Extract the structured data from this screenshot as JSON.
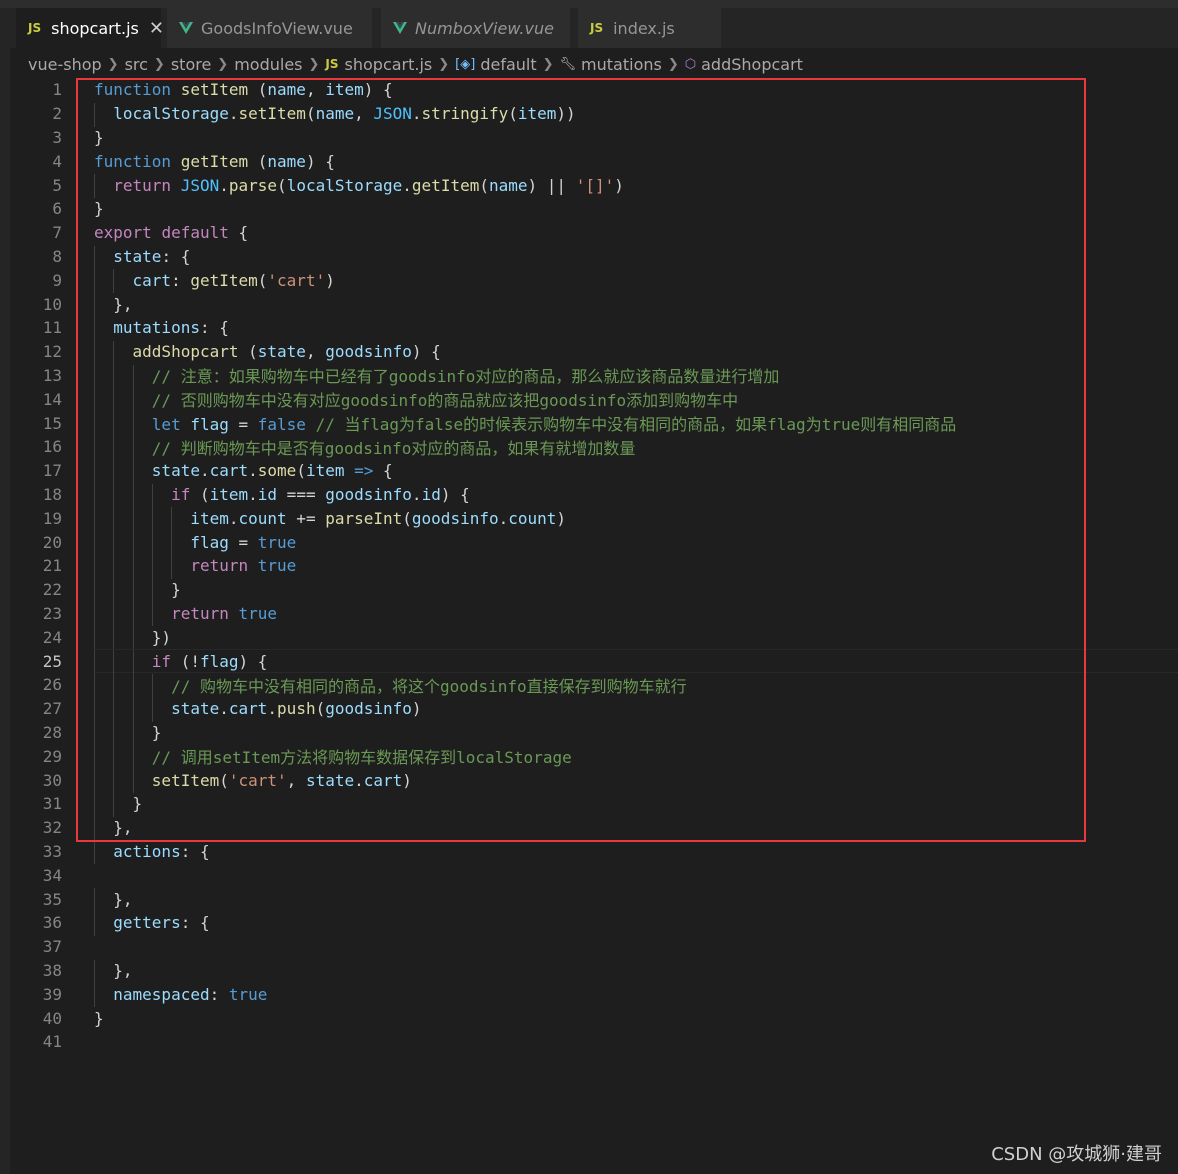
{
  "tabs": [
    {
      "icon": "JS",
      "label": "shopcart.js",
      "active": true,
      "close": "✕"
    },
    {
      "icon": "vue",
      "label": "GoodsInfoView.vue"
    },
    {
      "icon": "vue",
      "label": "NumboxView.vue"
    },
    {
      "icon": "JS",
      "label": "index.js"
    }
  ],
  "breadcrumb": [
    "vue-shop",
    "src",
    "store",
    "modules",
    "shopcart.js",
    "default",
    "mutations",
    "addShopcart"
  ],
  "breadcrumb_js_icon": "JS",
  "line_numbers": [
    "1",
    "2",
    "3",
    "4",
    "5",
    "6",
    "7",
    "8",
    "9",
    "10",
    "11",
    "12",
    "13",
    "14",
    "15",
    "16",
    "17",
    "18",
    "19",
    "20",
    "21",
    "22",
    "23",
    "24",
    "25",
    "26",
    "27",
    "28",
    "29",
    "30",
    "31",
    "32",
    "33",
    "34",
    "35",
    "36",
    "37",
    "38",
    "39",
    "40",
    "41"
  ],
  "code_lines": [
    [
      [
        "kw",
        "function "
      ],
      [
        "fn",
        "setItem "
      ],
      [
        "",
        "("
      ],
      [
        "var",
        "name"
      ],
      [
        "",
        ", "
      ],
      [
        "var",
        "item"
      ],
      [
        "",
        ") {"
      ]
    ],
    [
      [
        "",
        "  "
      ],
      [
        "var",
        "localStorage"
      ],
      [
        "",
        "."
      ],
      [
        "fn",
        "setItem"
      ],
      [
        "",
        "("
      ],
      [
        "var",
        "name"
      ],
      [
        "",
        ", "
      ],
      [
        "obj",
        "JSON"
      ],
      [
        "",
        "."
      ],
      [
        "fn",
        "stringify"
      ],
      [
        "",
        "("
      ],
      [
        "var",
        "item"
      ],
      [
        "",
        "))"
      ]
    ],
    [
      [
        "",
        "}"
      ]
    ],
    [
      [
        "kw",
        "function "
      ],
      [
        "fn",
        "getItem "
      ],
      [
        "",
        "("
      ],
      [
        "var",
        "name"
      ],
      [
        "",
        ") {"
      ]
    ],
    [
      [
        "",
        "  "
      ],
      [
        "ctl",
        "return "
      ],
      [
        "obj",
        "JSON"
      ],
      [
        "",
        "."
      ],
      [
        "fn",
        "parse"
      ],
      [
        "",
        "("
      ],
      [
        "var",
        "localStorage"
      ],
      [
        "",
        "."
      ],
      [
        "fn",
        "getItem"
      ],
      [
        "",
        "("
      ],
      [
        "var",
        "name"
      ],
      [
        "",
        ") || "
      ],
      [
        "str",
        "'[]'"
      ],
      [
        "",
        ")"
      ]
    ],
    [
      [
        "",
        "}"
      ]
    ],
    [
      [
        "ctl",
        "export "
      ],
      [
        "ctl",
        "default "
      ],
      [
        "",
        "{"
      ]
    ],
    [
      [
        "",
        "  "
      ],
      [
        "var",
        "state"
      ],
      [
        "",
        ": {"
      ]
    ],
    [
      [
        "",
        "    "
      ],
      [
        "var",
        "cart"
      ],
      [
        "",
        ": "
      ],
      [
        "fn",
        "getItem"
      ],
      [
        "",
        "("
      ],
      [
        "str",
        "'cart'"
      ],
      [
        "",
        ")"
      ]
    ],
    [
      [
        "",
        "  },"
      ]
    ],
    [
      [
        "",
        "  "
      ],
      [
        "var",
        "mutations"
      ],
      [
        "",
        ": {"
      ]
    ],
    [
      [
        "",
        "    "
      ],
      [
        "fn",
        "addShopcart "
      ],
      [
        "",
        "("
      ],
      [
        "var",
        "state"
      ],
      [
        "",
        ", "
      ],
      [
        "var",
        "goodsinfo"
      ],
      [
        "",
        ") {"
      ]
    ],
    [
      [
        "",
        "      "
      ],
      [
        "cmt",
        "// 注意：如果购物车中已经有了goodsinfo对应的商品，那么就应该商品数量进行增加"
      ]
    ],
    [
      [
        "",
        "      "
      ],
      [
        "cmt",
        "// 否则购物车中没有对应goodsinfo的商品就应该把goodsinfo添加到购物车中"
      ]
    ],
    [
      [
        "",
        "      "
      ],
      [
        "kw",
        "let "
      ],
      [
        "var",
        "flag"
      ],
      [
        "",
        " = "
      ],
      [
        "kw",
        "false "
      ],
      [
        "cmt",
        "// 当flag为false的时候表示购物车中没有相同的商品，如果flag为true则有相同商品"
      ]
    ],
    [
      [
        "",
        "      "
      ],
      [
        "cmt",
        "// 判断购物车中是否有goodsinfo对应的商品，如果有就增加数量"
      ]
    ],
    [
      [
        "",
        "      "
      ],
      [
        "var",
        "state"
      ],
      [
        "",
        "."
      ],
      [
        "var",
        "cart"
      ],
      [
        "",
        "."
      ],
      [
        "fn",
        "some"
      ],
      [
        "",
        "("
      ],
      [
        "var",
        "item"
      ],
      [
        "kw",
        " => "
      ],
      [
        "",
        "{"
      ]
    ],
    [
      [
        "",
        "        "
      ],
      [
        "ctl",
        "if "
      ],
      [
        "",
        "("
      ],
      [
        "var",
        "item"
      ],
      [
        "",
        "."
      ],
      [
        "var",
        "id"
      ],
      [
        "",
        " === "
      ],
      [
        "var",
        "goodsinfo"
      ],
      [
        "",
        "."
      ],
      [
        "var",
        "id"
      ],
      [
        "",
        ") {"
      ]
    ],
    [
      [
        "",
        "          "
      ],
      [
        "var",
        "item"
      ],
      [
        "",
        "."
      ],
      [
        "var",
        "count"
      ],
      [
        "",
        " += "
      ],
      [
        "fn",
        "parseInt"
      ],
      [
        "",
        "("
      ],
      [
        "var",
        "goodsinfo"
      ],
      [
        "",
        "."
      ],
      [
        "var",
        "count"
      ],
      [
        "",
        ")"
      ]
    ],
    [
      [
        "",
        "          "
      ],
      [
        "var",
        "flag"
      ],
      [
        "",
        " = "
      ],
      [
        "kw",
        "true"
      ]
    ],
    [
      [
        "",
        "          "
      ],
      [
        "ctl",
        "return "
      ],
      [
        "kw",
        "true"
      ]
    ],
    [
      [
        "",
        "        }"
      ]
    ],
    [
      [
        "",
        "        "
      ],
      [
        "ctl",
        "return "
      ],
      [
        "kw",
        "true"
      ]
    ],
    [
      [
        "",
        "      })"
      ]
    ],
    [
      [
        "",
        "      "
      ],
      [
        "ctl",
        "if "
      ],
      [
        "",
        "(!"
      ],
      [
        "var",
        "flag"
      ],
      [
        "",
        ") {"
      ]
    ],
    [
      [
        "",
        "        "
      ],
      [
        "cmt",
        "// 购物车中没有相同的商品，将这个goodsinfo直接保存到购物车就行"
      ]
    ],
    [
      [
        "",
        "        "
      ],
      [
        "var",
        "state"
      ],
      [
        "",
        "."
      ],
      [
        "var",
        "cart"
      ],
      [
        "",
        "."
      ],
      [
        "fn",
        "push"
      ],
      [
        "",
        "("
      ],
      [
        "var",
        "goodsinfo"
      ],
      [
        "",
        ")"
      ]
    ],
    [
      [
        "",
        "      }"
      ]
    ],
    [
      [
        "",
        "      "
      ],
      [
        "cmt",
        "// 调用setItem方法将购物车数据保存到localStorage"
      ]
    ],
    [
      [
        "",
        "      "
      ],
      [
        "fn",
        "setItem"
      ],
      [
        "",
        "("
      ],
      [
        "str",
        "'cart'"
      ],
      [
        "",
        ", "
      ],
      [
        "var",
        "state"
      ],
      [
        "",
        "."
      ],
      [
        "var",
        "cart"
      ],
      [
        "",
        ")"
      ]
    ],
    [
      [
        "",
        "    }"
      ]
    ],
    [
      [
        "",
        "  },"
      ]
    ],
    [
      [
        "",
        "  "
      ],
      [
        "var",
        "actions"
      ],
      [
        "",
        ": {"
      ]
    ],
    [
      [
        "",
        ""
      ]
    ],
    [
      [
        "",
        "  },"
      ]
    ],
    [
      [
        "",
        "  "
      ],
      [
        "var",
        "getters"
      ],
      [
        "",
        ": {"
      ]
    ],
    [
      [
        "",
        ""
      ]
    ],
    [
      [
        "",
        "  },"
      ]
    ],
    [
      [
        "",
        "  "
      ],
      [
        "var",
        "namespaced"
      ],
      [
        "",
        ": "
      ],
      [
        "kw",
        "true"
      ]
    ],
    [
      [
        "",
        "}"
      ]
    ],
    [
      [
        "",
        ""
      ]
    ]
  ],
  "current_line": 25,
  "watermark": "CSDN @攻城狮·建哥",
  "colors": {
    "highlight": "#e8383d",
    "keyword": "#569cd6",
    "control": "#c586c0",
    "function": "#dcdcaa",
    "variable": "#9cdcfe",
    "string": "#ce9178",
    "comment": "#6a9955"
  }
}
